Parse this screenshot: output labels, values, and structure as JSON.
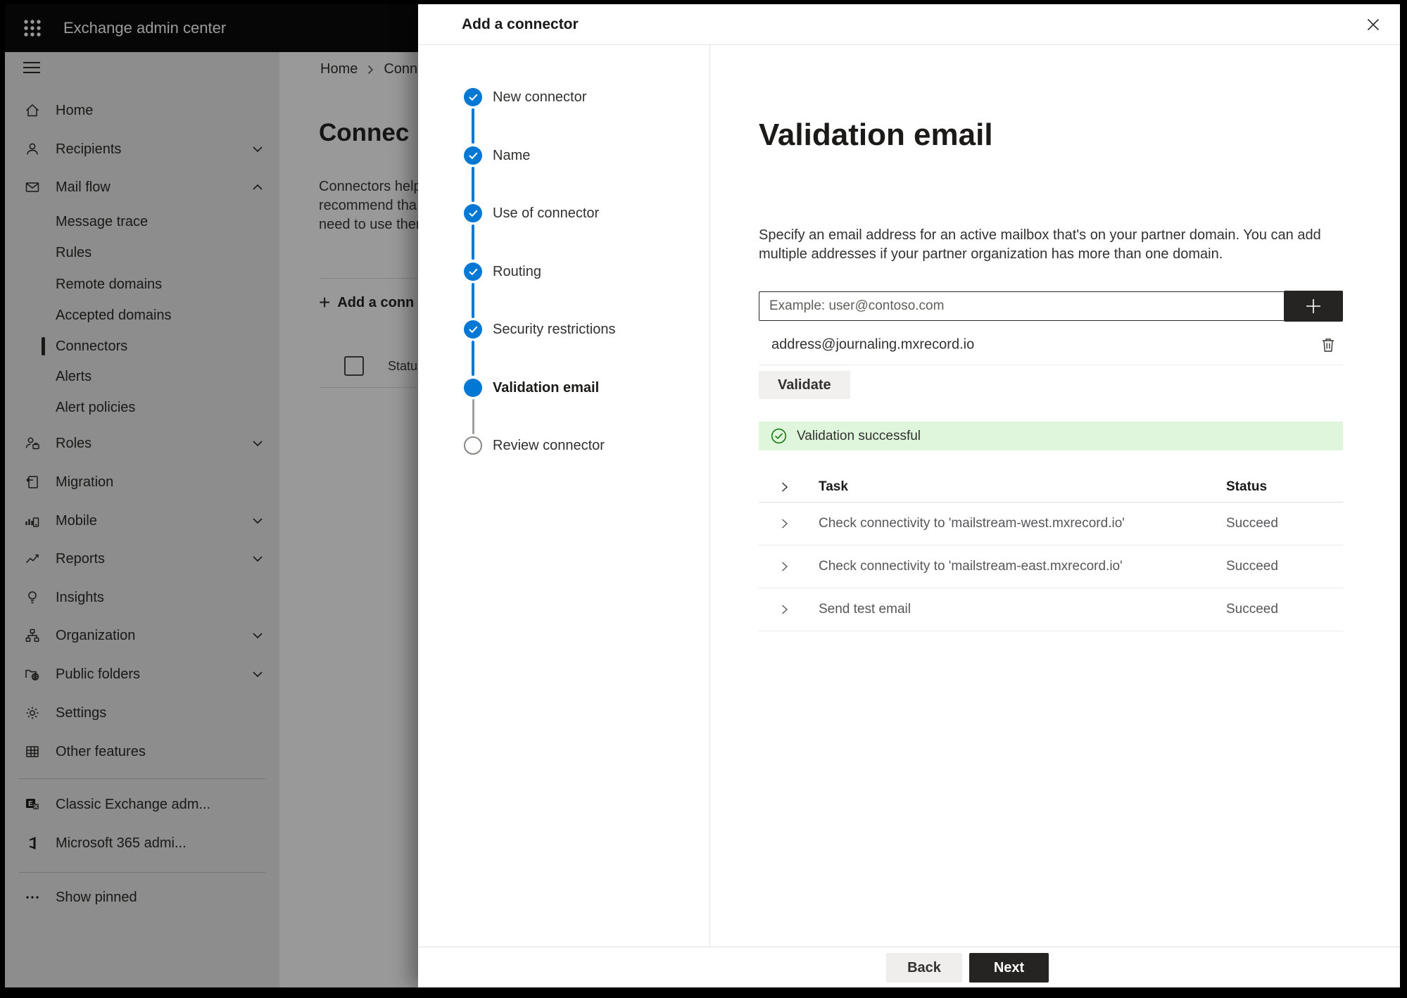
{
  "topbar": {
    "title": "Exchange admin center"
  },
  "sidebar": {
    "items": [
      {
        "label": "Home"
      },
      {
        "label": "Recipients"
      },
      {
        "label": "Mail flow"
      },
      {
        "label": "Message trace"
      },
      {
        "label": "Rules"
      },
      {
        "label": "Remote domains"
      },
      {
        "label": "Accepted domains"
      },
      {
        "label": "Connectors"
      },
      {
        "label": "Alerts"
      },
      {
        "label": "Alert policies"
      },
      {
        "label": "Roles"
      },
      {
        "label": "Migration"
      },
      {
        "label": "Mobile"
      },
      {
        "label": "Reports"
      },
      {
        "label": "Insights"
      },
      {
        "label": "Organization"
      },
      {
        "label": "Public folders"
      },
      {
        "label": "Settings"
      },
      {
        "label": "Other features"
      },
      {
        "label": "Classic Exchange adm..."
      },
      {
        "label": "Microsoft 365 admi..."
      },
      {
        "label": "Show pinned"
      }
    ]
  },
  "background": {
    "breadcrumb": {
      "home": "Home",
      "current": "Conne"
    },
    "page_title": "Connec",
    "intro_lines": [
      "Connectors help",
      "recommend tha",
      "need to use ther"
    ],
    "add_connector_label": "Add a conn",
    "status_header": "Status"
  },
  "panel": {
    "title": "Add a connector",
    "steps": [
      {
        "label": "New connector",
        "state": "done"
      },
      {
        "label": "Name",
        "state": "done"
      },
      {
        "label": "Use of connector",
        "state": "done"
      },
      {
        "label": "Routing",
        "state": "done"
      },
      {
        "label": "Security restrictions",
        "state": "done"
      },
      {
        "label": "Validation email",
        "state": "current"
      },
      {
        "label": "Review connector",
        "state": "todo"
      }
    ],
    "heading": "Validation email",
    "description": "Specify an email address for an active mailbox that's on your partner domain. You can add multiple addresses if your partner organization has more than one domain.",
    "email_input": {
      "placeholder": "Example: user@contoso.com"
    },
    "addresses": [
      {
        "email": "address@journaling.mxrecord.io"
      }
    ],
    "validate_label": "Validate",
    "success_message": "Validation successful",
    "table": {
      "task_header": "Task",
      "status_header": "Status",
      "rows": [
        {
          "task": "Check connectivity to 'mailstream-west.mxrecord.io'",
          "status": "Succeed"
        },
        {
          "task": "Check connectivity to 'mailstream-east.mxrecord.io'",
          "status": "Succeed"
        },
        {
          "task": "Send test email",
          "status": "Succeed"
        }
      ]
    },
    "back_label": "Back",
    "next_label": "Next"
  },
  "colors": {
    "accent": "#0078d4",
    "success_bg": "#dff6dd",
    "success_green": "#107c10"
  }
}
